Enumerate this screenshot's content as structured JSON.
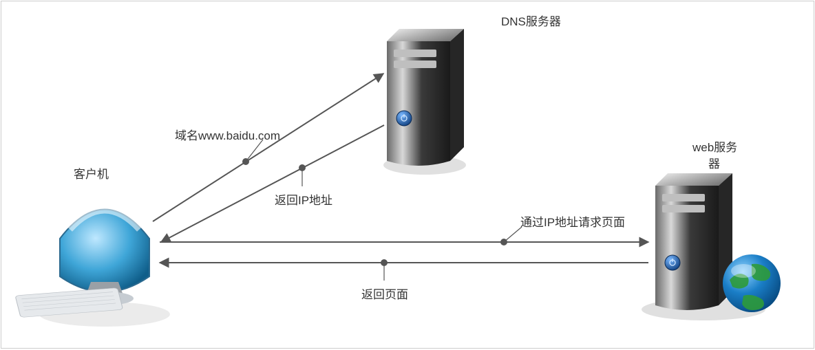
{
  "nodes": {
    "client": {
      "label": "客户机"
    },
    "dns": {
      "label": "DNS服务器"
    },
    "web": {
      "label_line1": "web服务",
      "label_line2": "器"
    }
  },
  "edges": {
    "to_dns": {
      "label": "域名www.baidu.com"
    },
    "from_dns": {
      "label": "返回IP地址"
    },
    "to_web": {
      "label": "通过IP地址请求页面"
    },
    "from_web": {
      "label": "返回页面"
    }
  }
}
